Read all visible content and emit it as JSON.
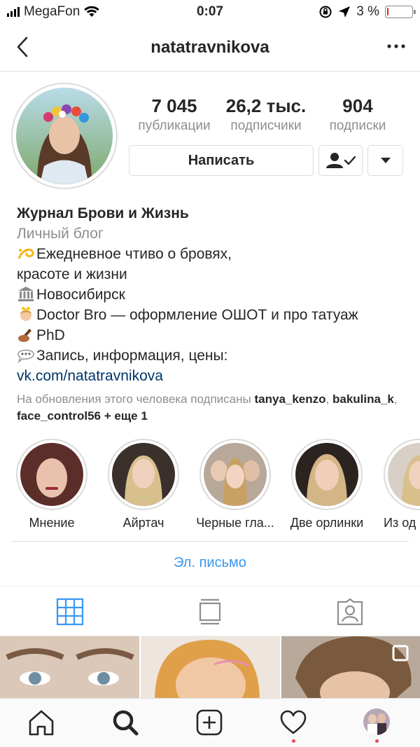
{
  "status_bar": {
    "carrier": "MegaFon",
    "time": "0:07",
    "battery": "3 %",
    "battery_level": 0.03
  },
  "nav": {
    "username": "natatravnikova",
    "back_icon": "chevron-left-icon",
    "more_icon": "more-dots-icon"
  },
  "stats": [
    {
      "value": "7 045",
      "label": "публикации"
    },
    {
      "value": "26,2 тыс.",
      "label": "подписчики"
    },
    {
      "value": "904",
      "label": "подписки"
    }
  ],
  "actions": {
    "message_label": "Написать",
    "following_icon": "person-check-icon",
    "dropdown_icon": "triangle-down-icon"
  },
  "bio": {
    "name": "Журнал Брови и Жизнь",
    "category": "Личный блог",
    "lines": [
      "Ежедневное чтиво о бровях,",
      "красоте и жизни",
      "Новосибирск",
      "Doctor Bro — оформление ОШОТ и про татуаж",
      "PhD",
      "Запись, информация, цены:"
    ],
    "link": "vk.com/natatravnikova"
  },
  "followed_by": {
    "prefix": "На обновления этого человека подписаны",
    "user1": "tanya_kenzo",
    "user2": "bakulina_k",
    "user3": "face_control56",
    "more": "+ еще 1"
  },
  "highlights": [
    {
      "label": "Мнение"
    },
    {
      "label": "Айртач"
    },
    {
      "label": "Черные гла..."
    },
    {
      "label": "Две орлинки"
    },
    {
      "label": "Из од"
    }
  ],
  "email_button": "Эл. письмо",
  "tabs": [
    "grid-icon",
    "feed-icon",
    "tagged-icon"
  ],
  "bottom_nav": [
    "home-icon",
    "search-icon",
    "add-icon",
    "heart-icon",
    "profile-avatar"
  ],
  "colors": {
    "link": "#003569",
    "accent": "#3897f0",
    "muted": "#8e8e8e",
    "notification": "#ed4956"
  }
}
